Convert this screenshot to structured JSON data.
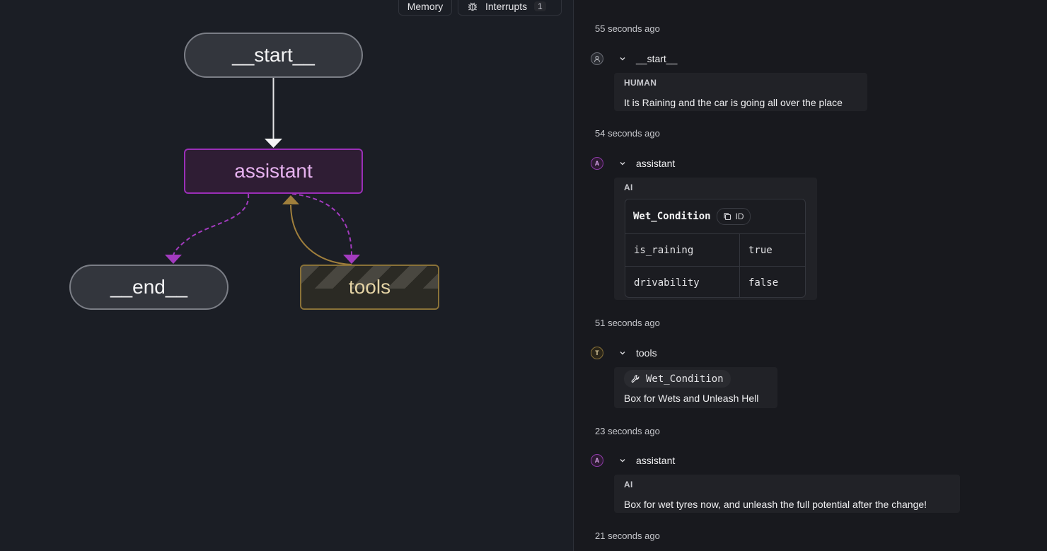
{
  "toolbar": {
    "memory_label": "Memory",
    "interrupts_label": "Interrupts",
    "interrupts_count": "1"
  },
  "graph": {
    "nodes": {
      "start": "__start__",
      "assistant": "assistant",
      "end": "__end__",
      "tools": "tools"
    }
  },
  "colors": {
    "assistant_border": "#9a2fb7",
    "tools_border": "#8a7238",
    "conditional_edge": "#a33bbf",
    "tool_return_edge": "#a07f3c"
  },
  "thread": {
    "entries": [
      {
        "time": "55 seconds ago",
        "avatar": "",
        "avatar_icon": "user-icon",
        "node": "__start__",
        "role_label": "HUMAN",
        "text": "It is Raining and the car is going all over the place"
      },
      {
        "time": "54 seconds ago",
        "avatar": "A",
        "node": "assistant",
        "role_label": "AI",
        "tool_call": {
          "name": "Wet_Condition",
          "id_label": "ID",
          "args": [
            {
              "key": "is_raining",
              "value": "true"
            },
            {
              "key": "drivability",
              "value": "false"
            }
          ]
        }
      },
      {
        "time": "51 seconds ago",
        "avatar": "T",
        "node": "tools",
        "tool_name": "Wet_Condition",
        "text": "Box for Wets and Unleash Hell"
      },
      {
        "time": "23 seconds ago",
        "avatar": "A",
        "node": "assistant",
        "role_label": "AI",
        "text": "Box for wet tyres now, and unleash the full potential after the change!"
      },
      {
        "time": "21 seconds ago"
      }
    ]
  }
}
